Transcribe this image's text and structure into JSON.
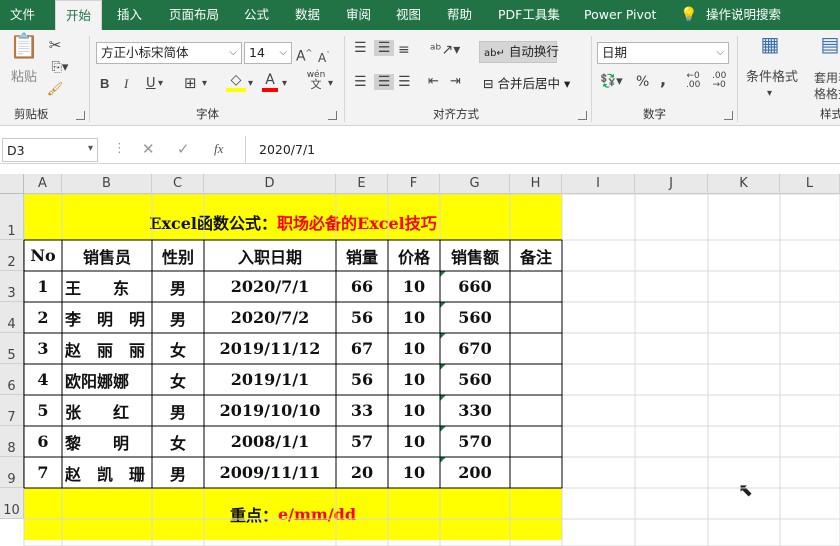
{
  "tabs": [
    "文件",
    "开始",
    "插入",
    "页面布局",
    "公式",
    "数据",
    "审阅",
    "视图",
    "帮助",
    "PDF工具集",
    "Power Pivot",
    "操作说明搜索"
  ],
  "clipboard": {
    "paste_label": "粘贴",
    "group_label": "剪贴板"
  },
  "font": {
    "name": "方正小标宋简体",
    "size": "14",
    "group_label": "字体",
    "bold": "B",
    "italic": "I",
    "underline": "U",
    "grow": "A",
    "shrink": "A",
    "wen": "wén",
    "phonetic": "文"
  },
  "align": {
    "wrap_label": "自动换行",
    "merge_label": "合并后居中",
    "group_label": "对齐方式"
  },
  "number": {
    "format": "日期",
    "group_label": "数字",
    "percent": "%",
    "comma": ","
  },
  "styles": {
    "cond_format_label": "条件格式",
    "table_format_label": "套用表格格式",
    "group_label": "样式"
  },
  "formula_bar": {
    "name_box": "D3",
    "value": "2020/7/1",
    "fx": "fx"
  },
  "columns": [
    "A",
    "B",
    "C",
    "D",
    "E",
    "F",
    "G",
    "H",
    "I",
    "J",
    "K",
    "L"
  ],
  "rows": [
    "1",
    "2",
    "3",
    "4",
    "5",
    "6",
    "7",
    "8",
    "9",
    "10"
  ],
  "sheet": {
    "title_black": "Excel函数公式：",
    "title_red": "职场必备的Excel技巧",
    "headers": [
      "No",
      "销售员",
      "性别",
      "入职日期",
      "销量",
      "价格",
      "销售额",
      "备注"
    ],
    "data": [
      [
        "1",
        "王　　东",
        "男",
        "2020/7/1",
        "66",
        "10",
        "660",
        ""
      ],
      [
        "2",
        "李　明　明",
        "男",
        "2020/7/2",
        "56",
        "10",
        "560",
        ""
      ],
      [
        "3",
        "赵　丽　丽",
        "女",
        "2019/11/12",
        "67",
        "10",
        "670",
        ""
      ],
      [
        "4",
        "欧阳娜娜",
        "女",
        "2019/1/1",
        "56",
        "10",
        "560",
        ""
      ],
      [
        "5",
        "张　　红",
        "男",
        "2019/10/10",
        "33",
        "10",
        "330",
        ""
      ],
      [
        "6",
        "黎　　明",
        "女",
        "2008/1/1",
        "57",
        "10",
        "570",
        ""
      ],
      [
        "7",
        "赵　凯　珊",
        "男",
        "2009/11/11",
        "20",
        "10",
        "200",
        ""
      ]
    ],
    "footer_black": "重点：",
    "footer_red": "e/mm/dd"
  },
  "colors": {
    "ribbon_green": "#217346",
    "highlight_yellow": "#ffff00",
    "red_text": "#ff0000"
  }
}
